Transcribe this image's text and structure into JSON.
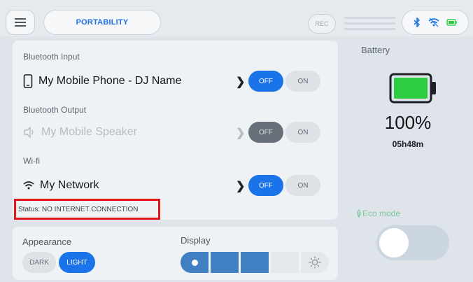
{
  "header": {
    "tab_label": "PORTABILITY",
    "rec_label": "REC"
  },
  "bluetooth_input": {
    "label": "Bluetooth Input",
    "device": "My Mobile Phone - DJ Name",
    "off_label": "OFF",
    "on_label": "ON",
    "state": "off"
  },
  "bluetooth_output": {
    "label": "Bluetooth Output",
    "device": "My Mobile Speaker",
    "off_label": "OFF",
    "on_label": "ON",
    "state": "off",
    "disabled": true
  },
  "wifi": {
    "label": "Wi-fi",
    "network": "My Network",
    "off_label": "OFF",
    "on_label": "ON",
    "state": "off",
    "status": "Status: NO INTERNET CONNECTION"
  },
  "appearance": {
    "label": "Appearance",
    "dark_label": "DARK",
    "light_label": "LIGHT",
    "selected": "LIGHT"
  },
  "display": {
    "label": "Display",
    "brightness_level": 3,
    "brightness_steps": 5
  },
  "battery": {
    "label": "Battery",
    "percent": "100%",
    "time_remaining": "05h48m",
    "charge_fraction": 1.0
  },
  "eco_mode": {
    "label": "Eco mode",
    "enabled": false
  },
  "colors": {
    "accent": "#1a73e8",
    "battery_fill": "#2ecc40",
    "eco_green": "#7fc79d",
    "alert_outline": "#e3161b"
  },
  "icons": {
    "menu": "hamburger-menu-icon",
    "bluetooth": "bluetooth-icon",
    "wifi": "wifi-icon",
    "battery_small": "battery-icon",
    "phone": "phone-icon",
    "speaker": "speaker-icon",
    "brightness": "sun-icon",
    "eco": "leaf-icon"
  }
}
